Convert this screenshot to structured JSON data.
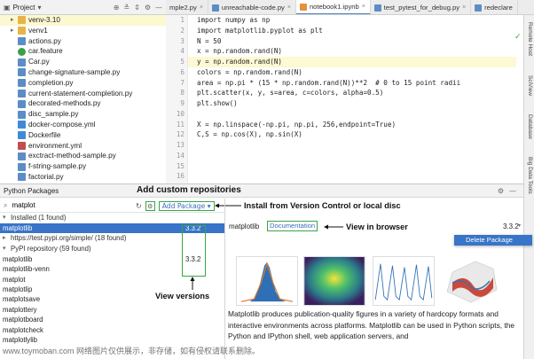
{
  "project": {
    "title": "Project",
    "tree": [
      {
        "label": "venv-3.10",
        "type": "folder",
        "arrow": true
      },
      {
        "label": "venv1",
        "type": "folder",
        "arrow": true
      },
      {
        "label": "actions.py",
        "type": "py"
      },
      {
        "label": "car.feature",
        "type": "feat"
      },
      {
        "label": "Car.py",
        "type": "py"
      },
      {
        "label": "change-signature-sample.py",
        "type": "py"
      },
      {
        "label": "completion.py",
        "type": "py"
      },
      {
        "label": "current-statement-completion.py",
        "type": "py"
      },
      {
        "label": "decorated-methods.py",
        "type": "py"
      },
      {
        "label": "disc_sample.py",
        "type": "py"
      },
      {
        "label": "docker-compose.yml",
        "type": "docker"
      },
      {
        "label": "Dockerfile",
        "type": "docker"
      },
      {
        "label": "environment.yml",
        "type": "yml"
      },
      {
        "label": "exctract-method-sample.py",
        "type": "py"
      },
      {
        "label": "f-string-sample.py",
        "type": "py"
      },
      {
        "label": "factorial.py",
        "type": "py"
      }
    ]
  },
  "tabs": [
    {
      "label": "mple2.py",
      "active": false
    },
    {
      "label": "unreachable-code.py",
      "active": false
    },
    {
      "label": "notebook1.ipynb",
      "active": true
    },
    {
      "label": "test_pytest_for_debug.py",
      "active": false
    },
    {
      "label": "redeclare",
      "active": false
    }
  ],
  "editor": {
    "lines": [
      {
        "n": "1",
        "code": "import numpy as np"
      },
      {
        "n": "2",
        "code": "import matplotlib.pyplot as plt"
      },
      {
        "n": "3",
        "code": "N = 50"
      },
      {
        "n": "4",
        "code": "x = np.random.rand(N)"
      },
      {
        "n": "5",
        "code": "y = np.random.rand(N)",
        "hl": true
      },
      {
        "n": "6",
        "code": "colors = np.random.rand(N)"
      },
      {
        "n": "7",
        "code": "area = np.pi * (15 * np.random.rand(N))**2  # 0 to 15 point radii"
      },
      {
        "n": "8",
        "code": "plt.scatter(x, y, s=area, c=colors, alpha=0.5)"
      },
      {
        "n": "9",
        "code": "plt.show()"
      },
      {
        "n": "10",
        "code": ""
      },
      {
        "n": "11",
        "code": "X = np.linspace(-np.pi, np.pi, 256,endpoint=True)"
      },
      {
        "n": "12",
        "code": "C,S = np.cos(X), np.sin(X)"
      },
      {
        "n": "13",
        "code": ""
      },
      {
        "n": "14",
        "code": ""
      },
      {
        "n": "15",
        "code": ""
      },
      {
        "n": "16",
        "code": ""
      }
    ]
  },
  "right_strip": [
    "Remote Host",
    "SciView",
    "Database",
    "Big Data Tools"
  ],
  "packages": {
    "title": "Python Packages",
    "search_value": "matplot",
    "add_package_label": "Add Package",
    "groups": {
      "installed": "Installed (1 found)",
      "testpypi": "https://test.pypi.org/simple/ (18 found)",
      "pypi": "PyPI repository (59 found)"
    },
    "installed": [
      {
        "name": "matplotlib",
        "version": "3.3.2"
      }
    ],
    "pypi": [
      {
        "name": "matplotlib",
        "version": "3.3.2"
      },
      {
        "name": "matplotlib-venn",
        "version": ""
      },
      {
        "name": "matplot",
        "version": ""
      },
      {
        "name": "matplotlip",
        "version": ""
      },
      {
        "name": "matplotsave",
        "version": ""
      },
      {
        "name": "matplottery",
        "version": ""
      },
      {
        "name": "matplotboard",
        "version": ""
      },
      {
        "name": "matplotcheck",
        "version": ""
      },
      {
        "name": "matplotlylib",
        "version": ""
      }
    ],
    "detail": {
      "name": "matplotlib",
      "documentation": "Documentation",
      "version": "3.3.2",
      "description": "Matplotlib produces publication-quality figures in a variety of hardcopy formats and interactive environments across platforms. Matplotlib can be used in Python scripts, the Python and IPython shell, web application servers, and"
    },
    "menu_delete": "Delete Package"
  },
  "annotations": {
    "add_custom_repos": "Add custom repositories",
    "install_from_vcs": "Install from Version Control or local disc",
    "view_in_browser": "View in browser",
    "view_versions": "View versions"
  },
  "watermark": "www.toymoban.com 网络图片仅供展示，非存储，如有侵权请联系删除。",
  "colors": {
    "accent": "#3874c8",
    "annotation_green": "#38a644",
    "highlight": "#fcf9d3"
  }
}
